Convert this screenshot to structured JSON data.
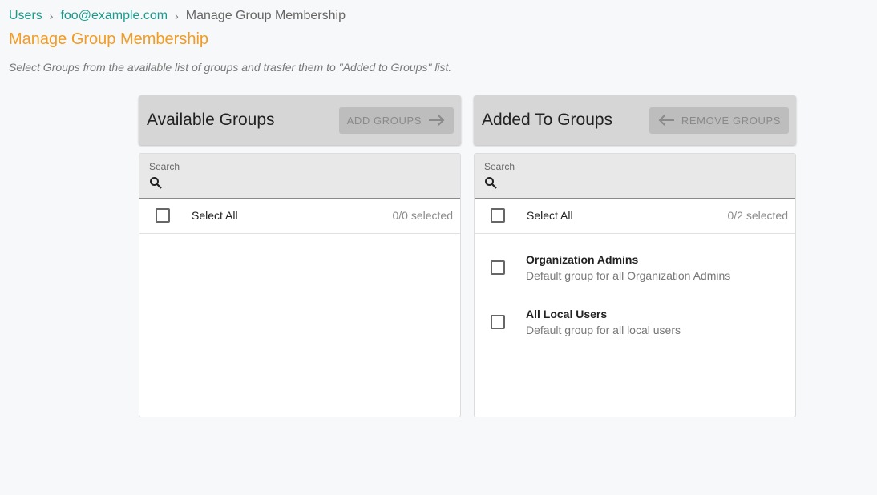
{
  "breadcrumb": {
    "items": [
      "Users",
      "foo@example.com"
    ],
    "current": "Manage Group Membership",
    "separator": "›"
  },
  "page": {
    "title": "Manage Group Membership",
    "description": "Select Groups from the available list of groups and trasfer them to \"Added to Groups\" list."
  },
  "available": {
    "title": "Available Groups",
    "button_label": "ADD GROUPS",
    "search_label": "Search",
    "search_value": "",
    "select_all_label": "Select All",
    "selected_count": "0/0 selected",
    "groups": []
  },
  "added": {
    "title": "Added To Groups",
    "button_label": "REMOVE GROUPS",
    "search_label": "Search",
    "search_value": "",
    "select_all_label": "Select All",
    "selected_count": "0/2 selected",
    "groups": [
      {
        "name": "Organization Admins",
        "description": "Default group for all Organization Admins"
      },
      {
        "name": "All Local Users",
        "description": "Default group for all local users"
      }
    ]
  },
  "colors": {
    "link": "#1a9c8c",
    "title": "#f39c21",
    "header_bg": "#d6d6d6",
    "button_disabled_bg": "#bdbdbd"
  }
}
